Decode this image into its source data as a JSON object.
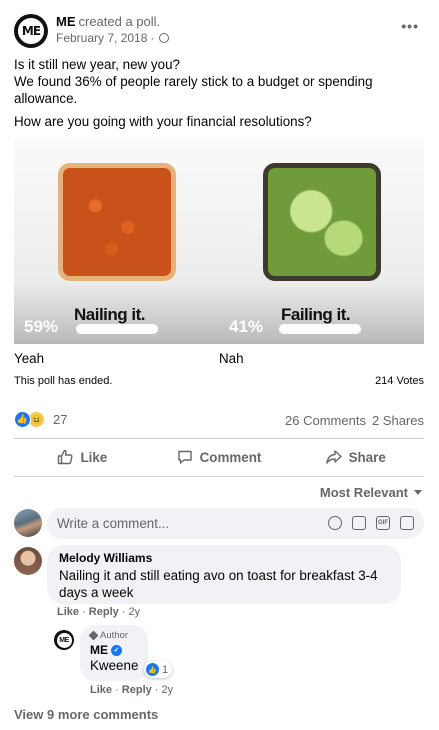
{
  "post": {
    "author": "ME",
    "action": "created a poll.",
    "date": "February 7, 2018",
    "separator": "·",
    "more": "•••",
    "text_lines": [
      "Is it still new year, new you?",
      "We found 36% of people rarely stick to a budget or spending allowance."
    ],
    "question": "How are you going with your financial resolutions?"
  },
  "poll": {
    "options": [
      {
        "image_caption": "Nailing it.",
        "percent": "59%",
        "label": "Yeah",
        "share": 0.59
      },
      {
        "image_caption": "Failing it.",
        "percent": "41%",
        "label": "Nah",
        "share": 0.41
      }
    ],
    "status": "This poll has ended.",
    "votes": "214 Votes"
  },
  "engagement": {
    "reaction_count": "27",
    "comments": "26 Comments",
    "shares": "2 Shares"
  },
  "actions": {
    "like": "Like",
    "comment": "Comment",
    "share": "Share"
  },
  "sort": {
    "label": "Most Relevant"
  },
  "composer": {
    "placeholder": "Write a comment..."
  },
  "comments": [
    {
      "name": "Melody Williams",
      "text": "Nailing it and still eating avo on toast for breakfast 3-4 days a week",
      "like": "Like",
      "reply": "Reply",
      "time": "2y",
      "replies": [
        {
          "badge": "Author",
          "name": "ME",
          "text": "Kweene",
          "reaction_count": "1",
          "like": "Like",
          "reply": "Reply",
          "time": "2y"
        }
      ]
    }
  ],
  "view_more": "View 9 more comments",
  "colors": {
    "facebook_blue": "#1877f2",
    "secondary_text": "#65676b",
    "bubble_bg": "#f0f2f5"
  }
}
